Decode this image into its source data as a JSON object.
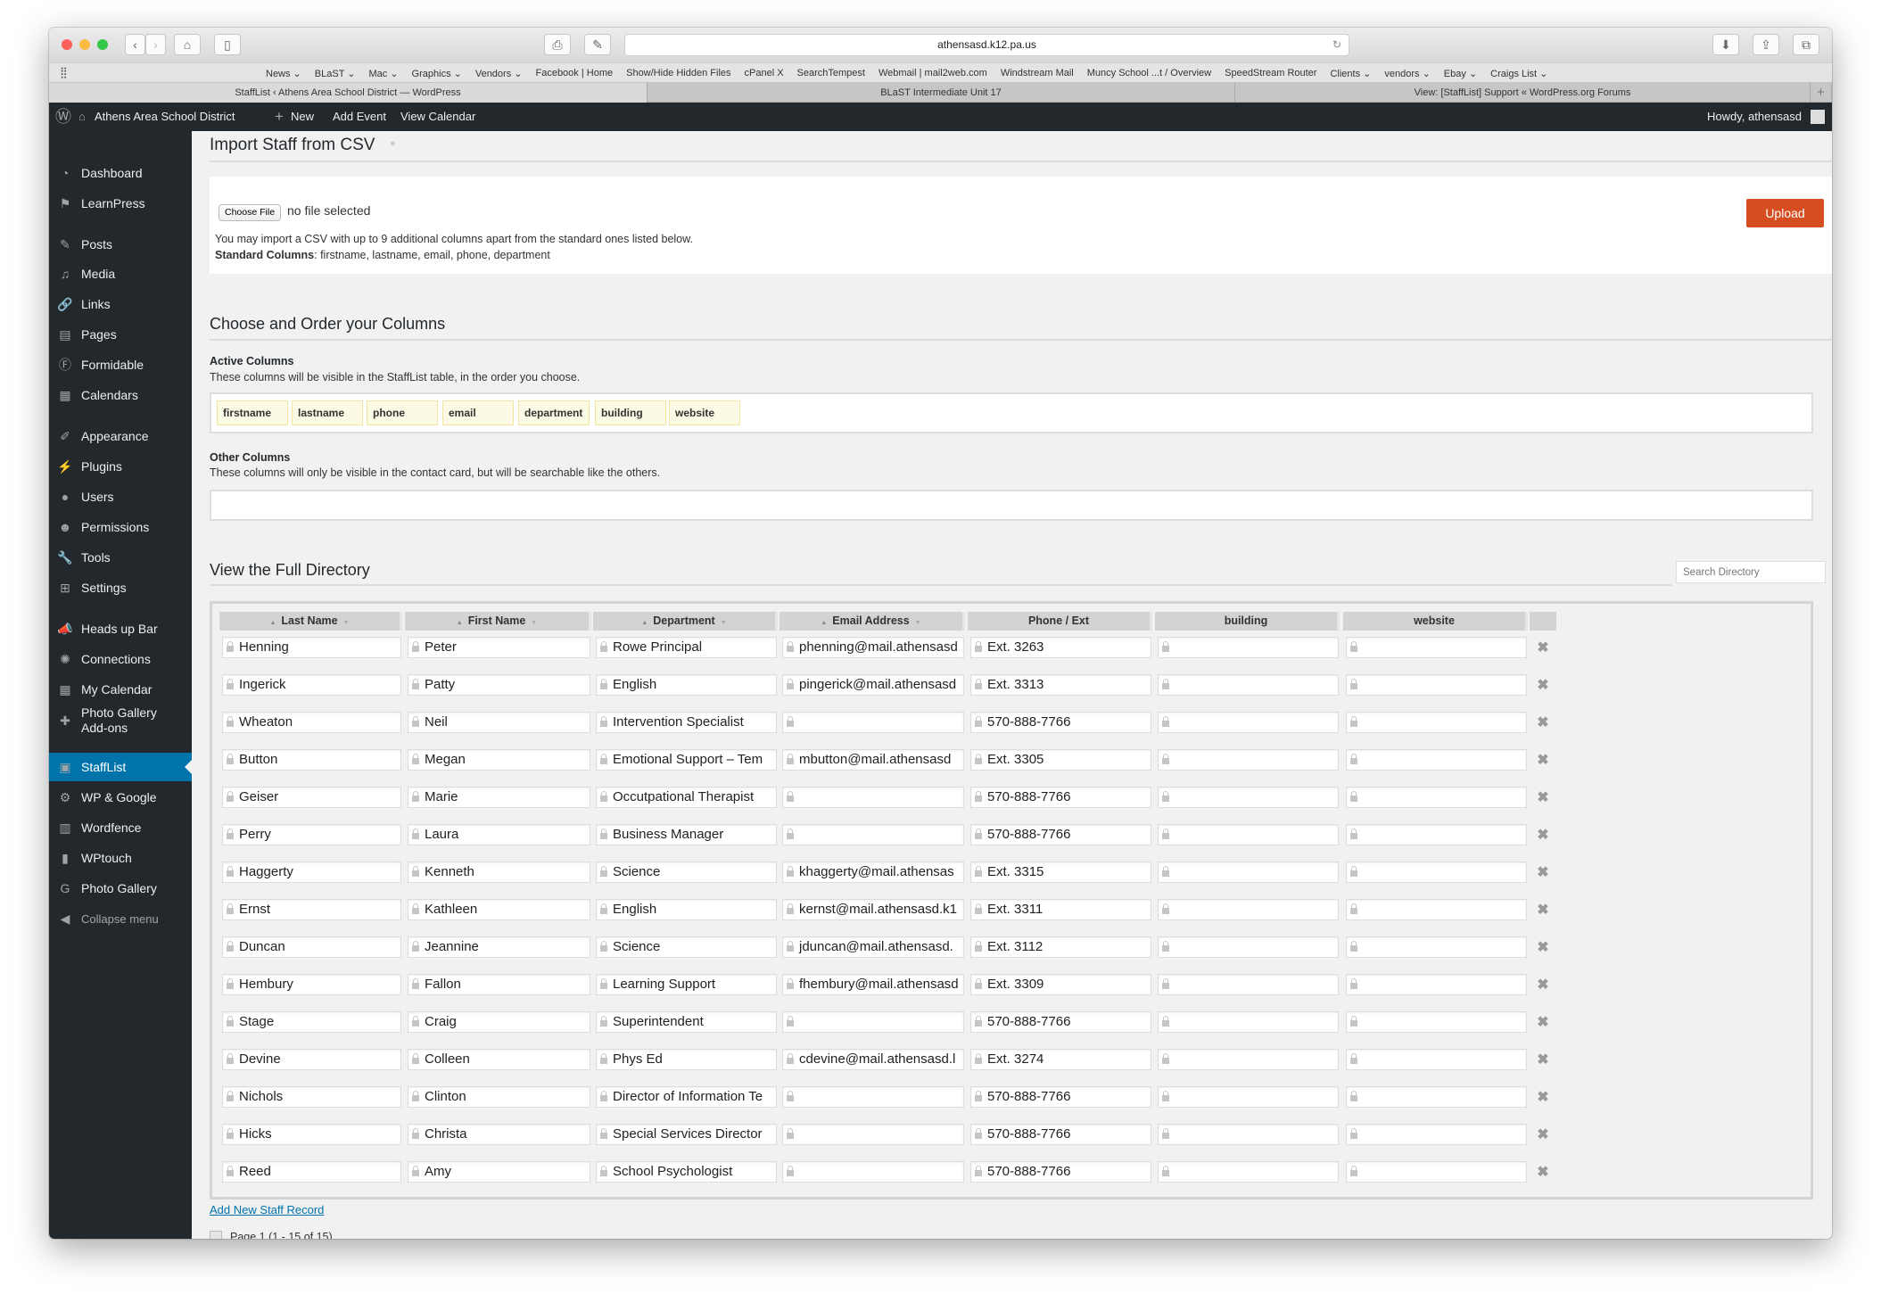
{
  "browser": {
    "url": "athensasd.k12.pa.us",
    "bookmarks": [
      "News ⌄",
      "BLaST ⌄",
      "Mac ⌄",
      "Graphics ⌄",
      "Vendors ⌄",
      "Facebook | Home",
      "Show/Hide Hidden Files",
      "cPanel X",
      "SearchTempest",
      "Webmail | mail2web.com",
      "Windstream Mail",
      "Muncy School ...t / Overview",
      "SpeedStream Router",
      "Clients ⌄",
      "vendors ⌄",
      "Ebay ⌄",
      "Craigs List ⌄"
    ],
    "tabs": [
      "StaffList ‹ Athens Area School District — WordPress",
      "BLaST Intermediate Unit 17",
      "View: [StaffList] Support « WordPress.org Forums"
    ],
    "new_tab": "+"
  },
  "adminbar": {
    "site": "Athens Area School District",
    "new": "New",
    "add_event": "Add Event",
    "view_calendar": "View Calendar",
    "howdy": "Howdy, athensasd"
  },
  "sidebar": {
    "items": [
      {
        "label": "Dashboard",
        "icon": "dashboard-icon",
        "glyph": "◔"
      },
      {
        "label": "LearnPress",
        "icon": "learnpress-icon",
        "glyph": "⚑"
      },
      {
        "label": "Posts",
        "icon": "pin-icon",
        "glyph": "✎"
      },
      {
        "label": "Media",
        "icon": "media-icon",
        "glyph": "♫"
      },
      {
        "label": "Links",
        "icon": "link-icon",
        "glyph": "🔗"
      },
      {
        "label": "Pages",
        "icon": "pages-icon",
        "glyph": "▤"
      },
      {
        "label": "Formidable",
        "icon": "formidable-icon",
        "glyph": "Ⓕ"
      },
      {
        "label": "Calendars",
        "icon": "calendar-icon",
        "glyph": "▦"
      },
      {
        "label": "Appearance",
        "icon": "brush-icon",
        "glyph": "✐"
      },
      {
        "label": "Plugins",
        "icon": "plugin-icon",
        "glyph": "⚡"
      },
      {
        "label": "Users",
        "icon": "user-icon",
        "glyph": "●"
      },
      {
        "label": "Permissions",
        "icon": "permissions-icon",
        "glyph": "☻"
      },
      {
        "label": "Tools",
        "icon": "wrench-icon",
        "glyph": "🔧"
      },
      {
        "label": "Settings",
        "icon": "settings-icon",
        "glyph": "⊞"
      },
      {
        "label": "Heads up Bar",
        "icon": "megaphone-icon",
        "glyph": "📣"
      },
      {
        "label": "Connections",
        "icon": "connections-icon",
        "glyph": "✺"
      },
      {
        "label": "My Calendar",
        "icon": "calendar-grid-icon",
        "glyph": "▦"
      },
      {
        "label": "Photo Gallery Add-ons",
        "icon": "puzzle-icon",
        "glyph": "✚"
      },
      {
        "label": "StaffList",
        "icon": "stafflist-icon",
        "glyph": "▣",
        "active": true
      },
      {
        "label": "WP & Google",
        "icon": "gear-icon",
        "glyph": "⚙"
      },
      {
        "label": "Wordfence",
        "icon": "wordfence-icon",
        "glyph": "▥"
      },
      {
        "label": "WPtouch",
        "icon": "phone-icon",
        "glyph": "▮"
      },
      {
        "label": "Photo Gallery",
        "icon": "photo-gallery-icon",
        "glyph": "G"
      },
      {
        "label": "Collapse menu",
        "icon": "collapse-icon",
        "glyph": "◀"
      }
    ]
  },
  "import": {
    "title": "Import Staff from CSV",
    "choose_file": "Choose File",
    "no_file": "no file selected",
    "note": "You may import a CSV with up to 9 additional columns apart from the standard ones listed below.",
    "standard_label": "Standard Columns",
    "standard_list": ": firstname, lastname, email, phone, department",
    "upload": "Upload"
  },
  "columns": {
    "title": "Choose and Order your Columns",
    "active_label": "Active Columns",
    "active_desc": "These columns will be visible in the StaffList table, in the order you choose.",
    "active": [
      "firstname",
      "lastname",
      "phone",
      "email",
      "department",
      "building",
      "website"
    ],
    "other_label": "Other Columns",
    "other_desc": "These columns will only be visible in the contact card, but will be searchable like the others."
  },
  "directory": {
    "title": "View the Full Directory",
    "search_placeholder": "Search Directory",
    "headers": [
      "Last Name",
      "First Name",
      "Department",
      "Email Address",
      "Phone / Ext",
      "building",
      "website"
    ],
    "sortable": [
      true,
      true,
      true,
      true,
      false,
      false,
      false
    ],
    "rows": [
      [
        "Henning",
        "Peter",
        "Rowe Principal",
        "phenning@mail.athensasd",
        "Ext. 3263",
        "",
        ""
      ],
      [
        "Ingerick",
        "Patty",
        "English",
        "pingerick@mail.athensasd",
        "Ext. 3313",
        "",
        ""
      ],
      [
        "Wheaton",
        "Neil",
        "Intervention Specialist",
        "",
        "570-888-7766",
        "",
        ""
      ],
      [
        "Button",
        "Megan",
        "Emotional Support – Tem",
        "mbutton@mail.athensasd",
        "Ext. 3305",
        "",
        ""
      ],
      [
        "Geiser",
        "Marie",
        "Occutpational Therapist",
        "",
        "570-888-7766",
        "",
        ""
      ],
      [
        "Perry",
        "Laura",
        "Business Manager",
        "",
        "570-888-7766",
        "",
        ""
      ],
      [
        "Haggerty",
        "Kenneth",
        "Science",
        "khaggerty@mail.athensas",
        "Ext. 3315",
        "",
        ""
      ],
      [
        "Ernst",
        "Kathleen",
        "English",
        "kernst@mail.athensasd.k1",
        "Ext. 3311",
        "",
        ""
      ],
      [
        "Duncan",
        "Jeannine",
        "Science",
        "jduncan@mail.athensasd.",
        "Ext. 3112",
        "",
        ""
      ],
      [
        "Hembury",
        "Fallon",
        "Learning Support",
        "fhembury@mail.athensasd",
        "Ext. 3309",
        "",
        ""
      ],
      [
        "Stage",
        "Craig",
        "Superintendent",
        "",
        "570-888-7766",
        "",
        ""
      ],
      [
        "Devine",
        "Colleen",
        "Phys Ed",
        "cdevine@mail.athensasd.l",
        "Ext. 3274",
        "",
        ""
      ],
      [
        "Nichols",
        "Clinton",
        "Director of Information Te",
        "",
        "570-888-7766",
        "",
        ""
      ],
      [
        "Hicks",
        "Christa",
        "Special Services Director",
        "",
        "570-888-7766",
        "",
        ""
      ],
      [
        "Reed",
        "Amy",
        "School Psychologist",
        "",
        "570-888-7766",
        "",
        ""
      ]
    ],
    "delete_glyph": "✖",
    "add_new": "Add New Staff Record",
    "pager": "Page 1 (1 - 15 of 15)"
  },
  "colors": {
    "accent": "#0073aa",
    "upload": "#d54e21",
    "admin": "#23282d"
  }
}
